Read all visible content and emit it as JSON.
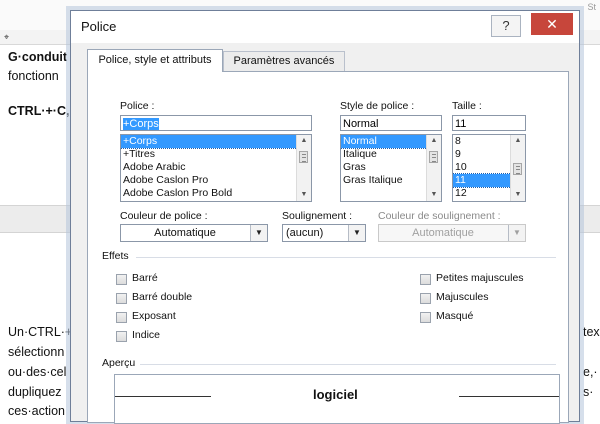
{
  "doc": {
    "line1": "G·conduit",
    "line2": "fonctionn",
    "line3": "CTRL·+·C,·",
    "para2": [
      "Un·CTRL·+·",
      "sélectionn",
      "ou·des·cel",
      "dupliquez",
      "ces·action"
    ],
    "right_fragments": [
      "tex",
      "e,·",
      "s·"
    ],
    "top_right": "St"
  },
  "dialog": {
    "title": "Police",
    "help": "?",
    "close": "✕",
    "tabs": [
      {
        "label": "Police, style et attributs",
        "active": true
      },
      {
        "label": "Paramètres avancés",
        "active": false
      }
    ]
  },
  "font": {
    "label": "Police :",
    "value": "+Corps",
    "items": [
      "+Corps",
      "+Titres",
      "Adobe Arabic",
      "Adobe Caslon Pro",
      "Adobe Caslon Pro Bold"
    ],
    "selected_index": 0
  },
  "style": {
    "label": "Style de police :",
    "value": "Normal",
    "items": [
      "Normal",
      "Italique",
      "Gras",
      "Gras Italique"
    ],
    "selected_index": 0
  },
  "size": {
    "label": "Taille :",
    "value": "11",
    "items": [
      "8",
      "9",
      "10",
      "11",
      "12"
    ],
    "selected_index": 3
  },
  "font_color": {
    "label": "Couleur de police :",
    "value": "Automatique"
  },
  "underline": {
    "label": "Soulignement :",
    "value": "(aucun)"
  },
  "underline_color": {
    "label": "Couleur de soulignement :",
    "value": "Automatique",
    "disabled": true
  },
  "effects": {
    "title": "Effets",
    "left": [
      {
        "label": "Barré",
        "checked": false
      },
      {
        "label": "Barré double",
        "checked": false
      },
      {
        "label": "Exposant",
        "checked": false
      },
      {
        "label": "Indice",
        "checked": false
      }
    ],
    "right": [
      {
        "label": "Petites majuscules",
        "checked": false
      },
      {
        "label": "Majuscules",
        "checked": false
      },
      {
        "label": "Masqué",
        "checked": false
      }
    ]
  },
  "preview": {
    "title": "Aperçu",
    "text": "logiciel"
  },
  "colors": {
    "selection": "#3399ff",
    "close_button": "#c7463b"
  }
}
